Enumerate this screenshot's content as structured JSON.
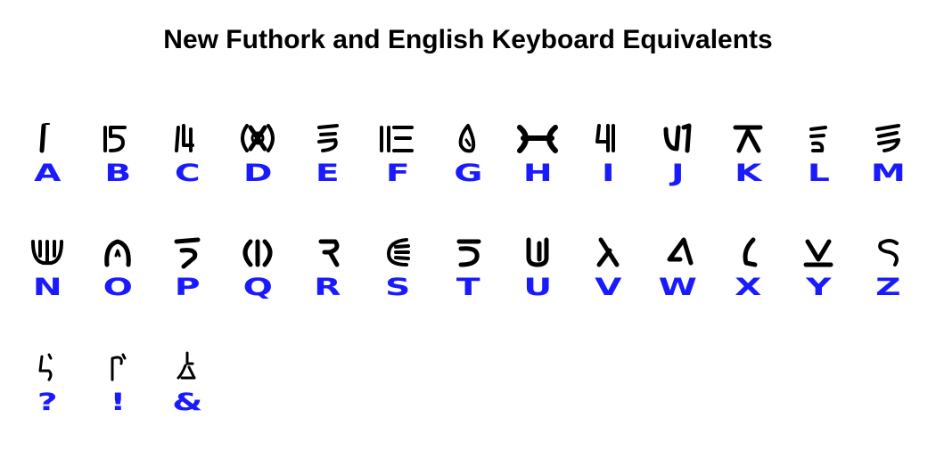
{
  "title": "New Futhork and English Keyboard Equivalents",
  "colors": {
    "latin": "#1a1aff",
    "glyph": "#000000",
    "background": "#ffffff"
  },
  "rows": [
    {
      "keys": [
        {
          "latin": "A",
          "glyph": "A"
        },
        {
          "latin": "B",
          "glyph": "B"
        },
        {
          "latin": "C",
          "glyph": "C"
        },
        {
          "latin": "D",
          "glyph": "D"
        },
        {
          "latin": "E",
          "glyph": "E"
        },
        {
          "latin": "F",
          "glyph": "F"
        },
        {
          "latin": "G",
          "glyph": "G"
        },
        {
          "latin": "H",
          "glyph": "H"
        },
        {
          "latin": "I",
          "glyph": "I"
        },
        {
          "latin": "J",
          "glyph": "J"
        },
        {
          "latin": "K",
          "glyph": "K"
        },
        {
          "latin": "L",
          "glyph": "L"
        },
        {
          "latin": "M",
          "glyph": "M"
        }
      ]
    },
    {
      "keys": [
        {
          "latin": "N",
          "glyph": "N"
        },
        {
          "latin": "O",
          "glyph": "O"
        },
        {
          "latin": "P",
          "glyph": "P"
        },
        {
          "latin": "Q",
          "glyph": "Q"
        },
        {
          "latin": "R",
          "glyph": "R"
        },
        {
          "latin": "S",
          "glyph": "S"
        },
        {
          "latin": "T",
          "glyph": "T"
        },
        {
          "latin": "U",
          "glyph": "U"
        },
        {
          "latin": "V",
          "glyph": "V"
        },
        {
          "latin": "W",
          "glyph": "W"
        },
        {
          "latin": "X",
          "glyph": "X"
        },
        {
          "latin": "Y",
          "glyph": "Y"
        },
        {
          "latin": "Z",
          "glyph": "Z"
        }
      ]
    },
    {
      "keys": [
        {
          "latin": "?",
          "glyph": "QUESTION"
        },
        {
          "latin": "!",
          "glyph": "EXCLAIM"
        },
        {
          "latin": "&",
          "glyph": "AMP"
        }
      ]
    }
  ]
}
